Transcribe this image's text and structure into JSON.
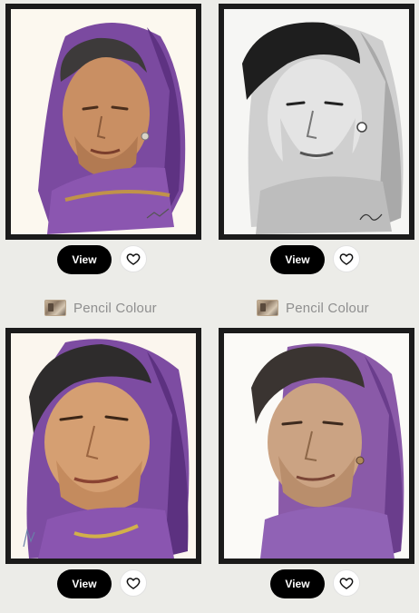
{
  "cards": [
    {
      "art": "color-purple-shawl-portrait",
      "view_label": "View",
      "favorite_icon": "heart-icon"
    },
    {
      "art": "graphite-portrait",
      "view_label": "View",
      "favorite_icon": "heart-icon"
    },
    {
      "art": "color-purple-shawl-portrait",
      "view_label": "View",
      "favorite_icon": "heart-icon"
    },
    {
      "art": "sepia-purple-shawl-portrait",
      "view_label": "View",
      "favorite_icon": "heart-icon"
    }
  ],
  "categories": [
    {
      "icon": "category-thumbnail-icon",
      "label": "Pencil Colour"
    },
    {
      "icon": "category-thumbnail-icon",
      "label": "Pencil Colour"
    }
  ],
  "colors": {
    "page_background": "#ecece8",
    "frame": "#1b1b1b",
    "view_button": "#000000",
    "shawl_purple": "#7a4a9c",
    "label_text": "#8f8f8f"
  }
}
